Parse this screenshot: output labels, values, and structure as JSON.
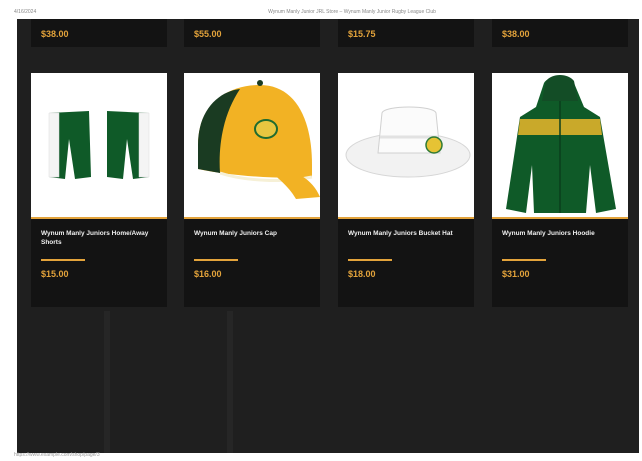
{
  "print_header": {
    "date": "4/16/2024",
    "title": "Wynum Manly Junior JRL Store – Wynum Manly Junior Rugby League Club"
  },
  "print_footer": "https://www.example.com/shop/page/3",
  "previous_row_prices": [
    "$38.00",
    "$55.00",
    "$15.75",
    "$38.00"
  ],
  "products": [
    {
      "name": "Wynum Manly Juniors Home/Away Shorts",
      "price": "$15.00",
      "image_icon": "shorts-icon"
    },
    {
      "name": "Wynum Manly Juniors Cap",
      "price": "$16.00",
      "image_icon": "cap-icon"
    },
    {
      "name": "Wynum Manly Juniors Bucket Hat",
      "price": "$18.00",
      "image_icon": "bucket-hat-icon"
    },
    {
      "name": "Wynum Manly Juniors Hoodie",
      "price": "$31.00",
      "image_icon": "hoodie-icon"
    }
  ],
  "colors": {
    "background": "#1f1f1f",
    "card": "#131313",
    "accent": "#e3a33b",
    "green": "#0f5a28"
  }
}
